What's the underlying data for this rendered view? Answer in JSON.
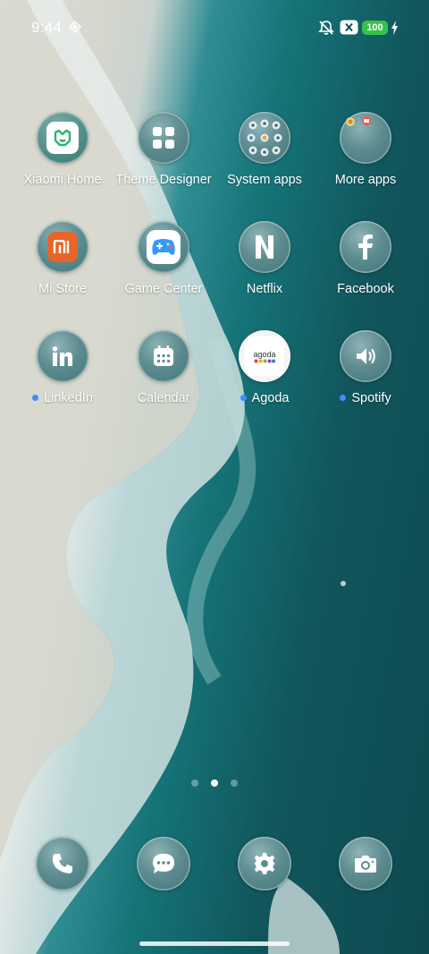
{
  "status_bar": {
    "time": "9:44",
    "battery": "100"
  },
  "apps": [
    {
      "label": "Xiaomi Home",
      "icon": "xiaomi-home-icon",
      "new": false
    },
    {
      "label": "Theme Designer",
      "icon": "theme-designer-icon",
      "new": false
    },
    {
      "label": "System apps",
      "icon": "system-apps-folder-icon",
      "new": false
    },
    {
      "label": "More apps",
      "icon": "more-apps-folder-icon",
      "new": false
    },
    {
      "label": "Mi Store",
      "icon": "mi-store-icon",
      "new": false
    },
    {
      "label": "Game Center",
      "icon": "game-center-icon",
      "new": false
    },
    {
      "label": "Netflix",
      "icon": "netflix-icon",
      "new": false
    },
    {
      "label": "Facebook",
      "icon": "facebook-icon",
      "new": false
    },
    {
      "label": "LinkedIn",
      "icon": "linkedin-icon",
      "new": true
    },
    {
      "label": "Calendar",
      "icon": "calendar-icon",
      "new": false
    },
    {
      "label": "Agoda",
      "icon": "agoda-icon",
      "new": true
    },
    {
      "label": "Spotify",
      "icon": "spotify-icon",
      "new": true
    }
  ],
  "agoda_logo_text": "agoda",
  "page_indicator": {
    "pages": 3,
    "active": 2
  },
  "dock": [
    {
      "icon": "phone-icon"
    },
    {
      "icon": "messages-icon"
    },
    {
      "icon": "settings-gear-icon"
    },
    {
      "icon": "camera-icon"
    }
  ],
  "colors": {
    "new_dot": "#3f8cff",
    "battery": "#36c24a",
    "mi_store_orange": "#e8652a",
    "xiaomi_home_green": "#2fb46e",
    "game_center_blue": "#2f9bff"
  }
}
